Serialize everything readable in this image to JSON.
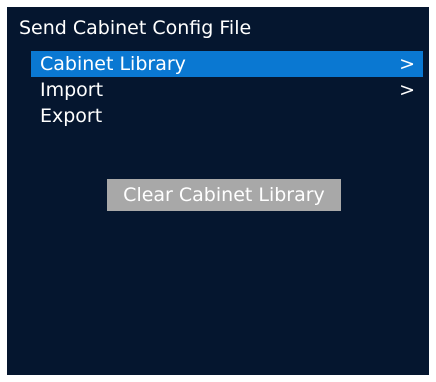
{
  "window": {
    "title": "Send Cabinet Config File"
  },
  "menu": {
    "items": [
      {
        "label": "Cabinet Library",
        "submenu_indicator": ">",
        "selected": true
      },
      {
        "label": "Import",
        "submenu_indicator": ">",
        "selected": false
      },
      {
        "label": "Export",
        "submenu_indicator": "",
        "selected": false
      }
    ]
  },
  "actions": {
    "clear_label": "Clear Cabinet Library"
  },
  "colors": {
    "screen_background": "#05162f",
    "selection_highlight": "#0a78d2",
    "button_background": "#a8a8a8",
    "text": "#ffffff"
  },
  "icons": {
    "submenu": "chevron-right-icon"
  }
}
